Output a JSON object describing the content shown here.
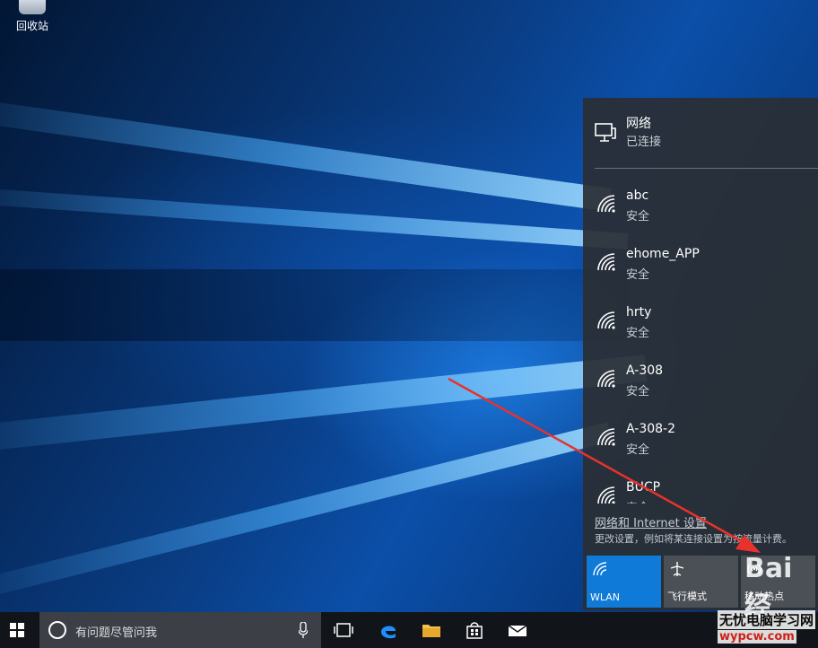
{
  "desktop": {
    "recycle_bin_label": "回收站"
  },
  "network_panel": {
    "header_title": "网络",
    "header_status": "已连接",
    "wifi_networks": [
      {
        "name": "abc",
        "status": "安全"
      },
      {
        "name": "ehome_APP",
        "status": "安全"
      },
      {
        "name": "hrty",
        "status": "安全"
      },
      {
        "name": "A-308",
        "status": "安全"
      },
      {
        "name": "A-308-2",
        "status": "安全"
      },
      {
        "name": "BUCP",
        "status": "安全"
      }
    ],
    "settings_link": "网络和 Internet 设置",
    "settings_desc": "更改设置，例如将某连接设置为按流量计费。",
    "quick_actions": [
      {
        "label": "WLAN",
        "icon": "wifi-icon",
        "active": true
      },
      {
        "label": "飞行模式",
        "icon": "airplane-icon",
        "active": false
      },
      {
        "label": "移动热点",
        "icon": "hotspot-icon",
        "active": false
      }
    ]
  },
  "taskbar": {
    "search_placeholder": "有问题尽管问我",
    "icons": [
      "start-icon",
      "cortana-icon",
      "microphone-icon",
      "task-view-icon",
      "edge-icon",
      "file-explorer-icon",
      "store-icon",
      "mail-icon"
    ]
  },
  "watermark": {
    "brand": "Bai",
    "suffix": "经",
    "line1": "无忧电脑学习网",
    "line2": "wypcw.com"
  },
  "colors": {
    "accent": "#0f7ad8",
    "panel_bg": "#2a2e34",
    "taskbar_bg": "#11151a",
    "arrow": "#e8322b"
  }
}
